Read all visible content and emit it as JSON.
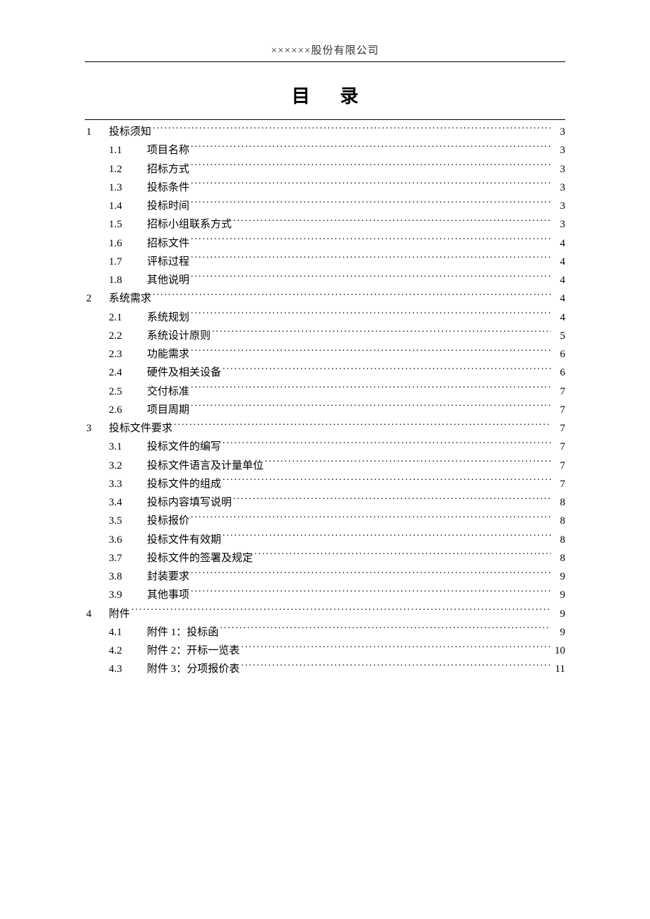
{
  "header": "××××××股份有限公司",
  "title": "目 录",
  "toc": [
    {
      "level": 1,
      "num": "1",
      "label": "投标须知",
      "page": "3"
    },
    {
      "level": 2,
      "num": "1.1",
      "label": "项目名称",
      "page": "3"
    },
    {
      "level": 2,
      "num": "1.2",
      "label": "招标方式",
      "page": "3"
    },
    {
      "level": 2,
      "num": "1.3",
      "label": "投标条件",
      "page": "3"
    },
    {
      "level": 2,
      "num": "1.4",
      "label": "投标时间",
      "page": "3"
    },
    {
      "level": 2,
      "num": "1.5",
      "label": "招标小组联系方式",
      "page": "3"
    },
    {
      "level": 2,
      "num": "1.6",
      "label": "招标文件",
      "page": "4"
    },
    {
      "level": 2,
      "num": "1.7",
      "label": "评标过程",
      "page": "4"
    },
    {
      "level": 2,
      "num": "1.8",
      "label": "其他说明",
      "page": "4"
    },
    {
      "level": 1,
      "num": "2",
      "label": "系统需求",
      "page": "4"
    },
    {
      "level": 2,
      "num": "2.1",
      "label": "系统规划",
      "page": "4"
    },
    {
      "level": 2,
      "num": "2.2",
      "label": "系统设计原则",
      "page": "5"
    },
    {
      "level": 2,
      "num": "2.3",
      "label": "功能需求",
      "page": "6"
    },
    {
      "level": 2,
      "num": "2.4",
      "label": "硬件及相关设备",
      "page": "6"
    },
    {
      "level": 2,
      "num": "2.5",
      "label": "交付标准",
      "page": "7"
    },
    {
      "level": 2,
      "num": "2.6",
      "label": "项目周期",
      "page": "7"
    },
    {
      "level": 1,
      "num": "3",
      "label": "投标文件要求",
      "page": "7"
    },
    {
      "level": 2,
      "num": "3.1",
      "label": "投标文件的编写",
      "page": "7"
    },
    {
      "level": 2,
      "num": "3.2",
      "label": "投标文件语言及计量单位",
      "page": "7"
    },
    {
      "level": 2,
      "num": "3.3",
      "label": "投标文件的组成",
      "page": "7"
    },
    {
      "level": 2,
      "num": "3.4",
      "label": "投标内容填写说明",
      "page": "8"
    },
    {
      "level": 2,
      "num": "3.5",
      "label": "投标报价",
      "page": "8"
    },
    {
      "level": 2,
      "num": "3.6",
      "label": "投标文件有效期",
      "page": "8"
    },
    {
      "level": 2,
      "num": "3.7",
      "label": "投标文件的签署及规定",
      "page": "8"
    },
    {
      "level": 2,
      "num": "3.8",
      "label": "封装要求",
      "page": "9"
    },
    {
      "level": 2,
      "num": "3.9",
      "label": "其他事项",
      "page": "9"
    },
    {
      "level": 1,
      "num": "4",
      "label": "附件",
      "page": "9"
    },
    {
      "level": 2,
      "num": "4.1",
      "label": "附件 1：投标函",
      "page": "9"
    },
    {
      "level": 2,
      "num": "4.2",
      "label": "附件 2：开标一览表",
      "page": "10"
    },
    {
      "level": 2,
      "num": "4.3",
      "label": "附件 3：分项报价表",
      "page": "11"
    }
  ]
}
